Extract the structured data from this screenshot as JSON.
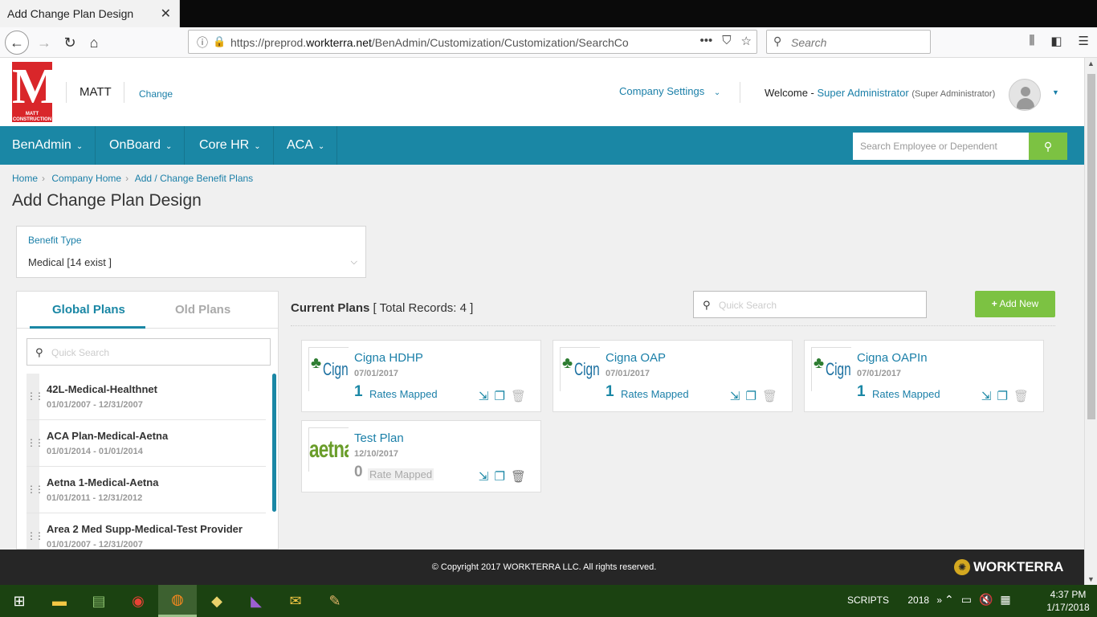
{
  "browser": {
    "tab_title": "Add Change Plan Design",
    "tab_close": "✕",
    "url_prefix": "https://preprod.",
    "url_domain": "workterra.net",
    "url_path": "/BenAdmin/Customization/Customization/SearchCo",
    "search_placeholder": "Search"
  },
  "header": {
    "logo_letter": "M",
    "logo_sub_1": "MATT",
    "logo_sub_2": "CONSTRUCTION",
    "company_name": "MATT",
    "change_label": "Change",
    "company_settings": "Company Settings",
    "welcome_label": "Welcome -",
    "user_name": "Super Administrator",
    "user_role": "(Super Administrator)"
  },
  "mainnav": {
    "items": [
      {
        "label": "BenAdmin"
      },
      {
        "label": "OnBoard"
      },
      {
        "label": "Core HR"
      },
      {
        "label": "ACA"
      }
    ],
    "search_placeholder": "Search Employee or Dependent"
  },
  "breadcrumb": [
    "Home",
    "Company Home",
    "Add / Change Benefit Plans"
  ],
  "page_title": "Add Change Plan Design",
  "benefit_type": {
    "label": "Benefit Type",
    "value": "Medical [14 exist ]"
  },
  "left_panel": {
    "tab_global": "Global Plans",
    "tab_old": "Old Plans",
    "search_placeholder": "Quick Search",
    "items": [
      {
        "name": "42L-Medical-Healthnet",
        "dates": "01/01/2007 - 12/31/2007"
      },
      {
        "name": "ACA Plan-Medical-Aetna",
        "dates": "01/01/2014 - 01/01/2014"
      },
      {
        "name": "Aetna 1-Medical-Aetna",
        "dates": "01/01/2011 - 12/31/2012"
      },
      {
        "name": "Area 2 Med Supp-Medical-Test Provider",
        "dates": "01/01/2007 - 12/31/2007"
      }
    ]
  },
  "current_plans": {
    "title": "Current Plans",
    "total": "[ Total Records: 4 ]",
    "search_placeholder": "Quick Search",
    "add_new": "Add New",
    "plans": [
      {
        "logo": "Cigna",
        "name": "Cigna HDHP",
        "date": "07/01/2017",
        "count": "1",
        "rates": "Rates Mapped"
      },
      {
        "logo": "Cigna",
        "name": "Cigna OAP",
        "date": "07/01/2017",
        "count": "1",
        "rates": "Rates Mapped"
      },
      {
        "logo": "Cigna",
        "name": "Cigna OAPIn",
        "date": "07/01/2017",
        "count": "1",
        "rates": "Rates Mapped"
      },
      {
        "logo": "aetna",
        "name": "Test Plan",
        "date": "12/10/2017",
        "count": "0",
        "rates": "Rate Mapped"
      }
    ]
  },
  "footer": {
    "copyright": "© Copyright 2017 WORKTERRA LLC. All rights reserved.",
    "brand_logo": "WORKTERRA"
  },
  "taskbar": {
    "tray_scripts": "SCRIPTS",
    "tray_year": "2018",
    "time": "4:37 PM",
    "date": "1/17/2018"
  },
  "colors": {
    "nav_bg": "#1a87a5",
    "accent_green": "#7cc242",
    "link_blue": "#1a7fa8",
    "logo_red": "#d9262a"
  }
}
